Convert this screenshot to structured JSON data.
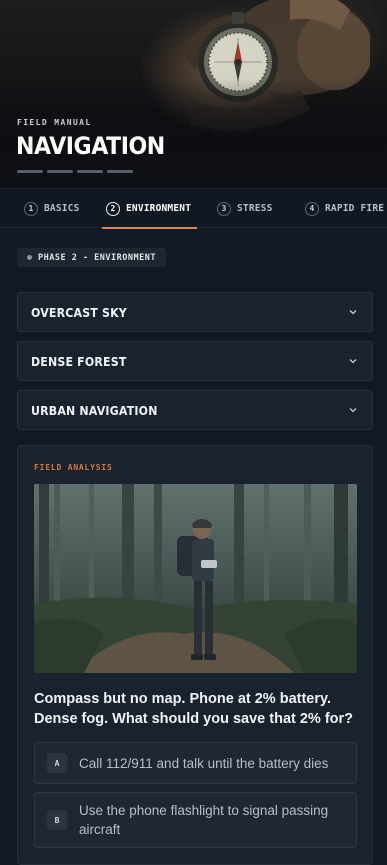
{
  "hero": {
    "eyebrow": "FIELD MANUAL",
    "title": "NAVIGATION",
    "progress_segments": 4,
    "image_subject": "hand-holding-lensatic-compass"
  },
  "tabs": [
    {
      "num": "1",
      "label": "BASICS",
      "active": false
    },
    {
      "num": "2",
      "label": "ENVIRONMENT",
      "active": true
    },
    {
      "num": "3",
      "label": "STRESS",
      "active": false
    },
    {
      "num": "4",
      "label": "RAPID FIRE",
      "active": false
    }
  ],
  "phase_chip": "PHASE 2 - ENVIRONMENT",
  "accordions": [
    {
      "label": "OVERCAST SKY",
      "icon": "chevron-down-icon"
    },
    {
      "label": "DENSE FOREST",
      "icon": "chevron-down-icon"
    },
    {
      "label": "URBAN NAVIGATION",
      "icon": "chevron-down-icon"
    }
  ],
  "field_analysis": {
    "label": "FIELD ANALYSIS",
    "image_subject": "hiker-in-foggy-forest-at-trail-fork",
    "question": "Compass but no map. Phone at 2% battery. Dense fog. What should you save that 2% for?",
    "options": [
      {
        "key": "A",
        "text": "Call 112/911 and talk until the battery dies"
      },
      {
        "key": "B",
        "text": "Use the phone flashlight to signal passing aircraft"
      }
    ]
  },
  "colors": {
    "background": "#131923",
    "card": "#1a222e",
    "accent": "#d3854a",
    "label_orange": "#d07a3c"
  }
}
